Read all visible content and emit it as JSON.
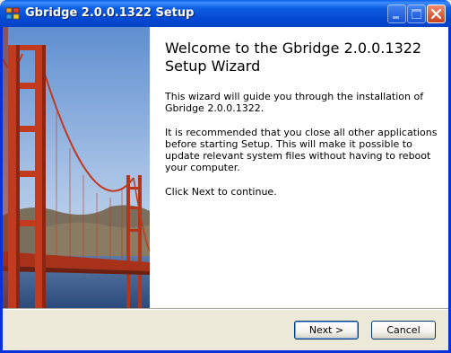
{
  "window": {
    "title": "Gbridge 2.0.0.1322 Setup"
  },
  "titlebar_buttons": {
    "minimize": "minimize",
    "maximize": "maximize",
    "close": "close"
  },
  "wizard": {
    "heading": "Welcome to the Gbridge 2.0.0.1322\nSetup Wizard",
    "paragraphs": [
      "This wizard will guide you through the installation of Gbridge 2.0.0.1322.",
      "It is recommended that you close all other applications before starting Setup. This will make it possible to update relevant system files without having to reboot your computer.",
      "Click Next to continue."
    ]
  },
  "buttons": {
    "next": "Next >",
    "cancel": "Cancel"
  },
  "colors": {
    "titlebar": "#0548d2",
    "dialog_bg": "#ece9d8",
    "content_bg": "#ffffff",
    "bridge": "#c0391f"
  }
}
